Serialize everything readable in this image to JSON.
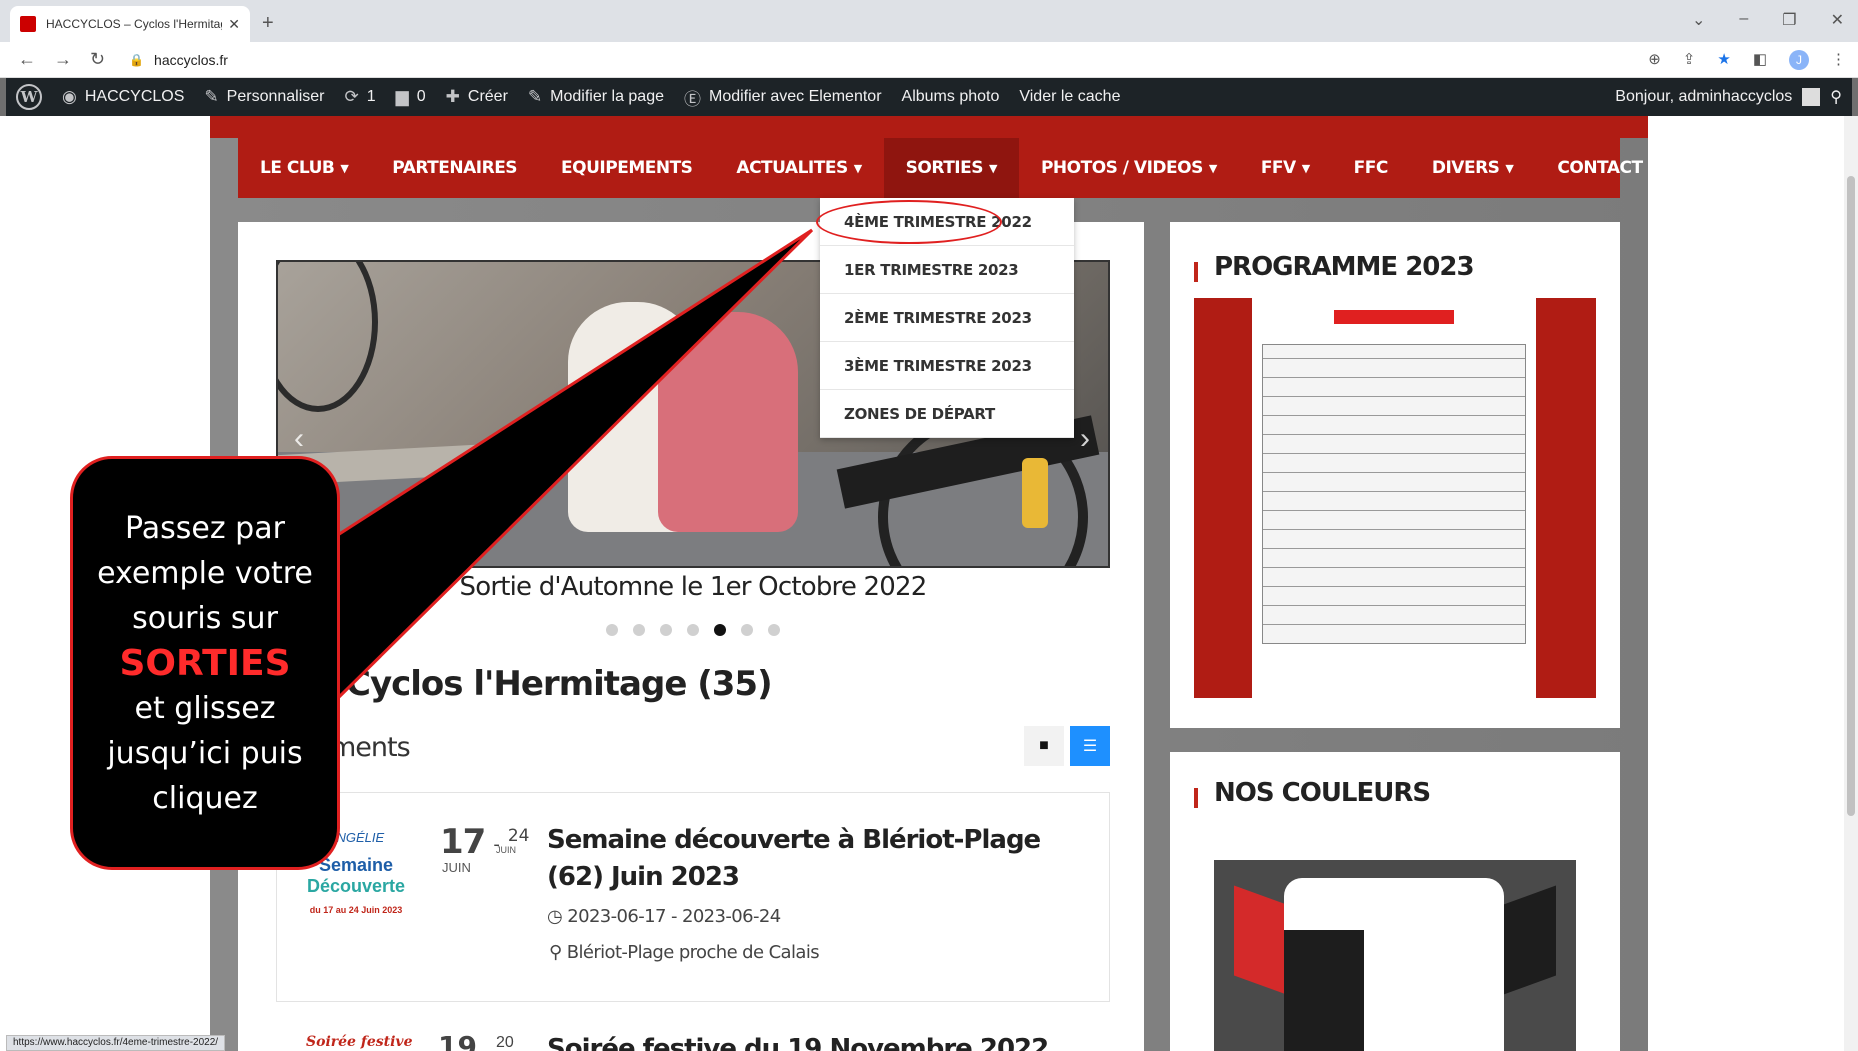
{
  "browser": {
    "tab_title": "HACCYCLOS – Cyclos l'Hermitage",
    "new_tab": "+",
    "url": "haccyclos.fr",
    "status_url": "https://www.haccyclos.fr/4eme-trimestre-2022/"
  },
  "adminbar": {
    "site_name": "HACCYCLOS",
    "customize": "Personnaliser",
    "updates_count": "1",
    "comments_count": "0",
    "create": "Créer",
    "edit_page": "Modifier la page",
    "edit_elementor": "Modifier avec Elementor",
    "albums": "Albums photo",
    "clear_cache": "Vider le cache",
    "greeting": "Bonjour, adminhaccyclos"
  },
  "nav": {
    "items": [
      {
        "label": "LE CLUB",
        "has_sub": true
      },
      {
        "label": "PARTENAIRES",
        "has_sub": false
      },
      {
        "label": "EQUIPEMENTS",
        "has_sub": false
      },
      {
        "label": "ACTUALITES",
        "has_sub": true
      },
      {
        "label": "SORTIES",
        "has_sub": true
      },
      {
        "label": "PHOTOS / VIDEOS",
        "has_sub": true
      },
      {
        "label": "FFV",
        "has_sub": true
      },
      {
        "label": "FFC",
        "has_sub": false
      },
      {
        "label": "DIVERS",
        "has_sub": true
      },
      {
        "label": "CONTACT",
        "has_sub": false
      }
    ],
    "dropdown": [
      "4ÈME TRIMESTRE 2022",
      "1ER TRIMESTRE 2023",
      "2ÈME TRIMESTRE 2023",
      "3ÈME TRIMESTRE 2023",
      "ZONES DE DÉPART"
    ]
  },
  "slider": {
    "caption": "Sortie d'Automne le 1er Octobre 2022",
    "active_dot": 4,
    "dot_count": 7
  },
  "main": {
    "club_title": "Cyclos l'Hermitage (35)",
    "events_sub": "ments"
  },
  "events": [
    {
      "thumb_top": "ANGÉLIE",
      "thumb_line1": "Semaine",
      "thumb_line2": "Découverte",
      "thumb_dates": "du 17 au 24 Juin 2023",
      "day_start": "17",
      "day_end": "24",
      "month_start": "JUIN",
      "month_end": "JUIN",
      "title": "Semaine découverte à Blériot-Plage (62) Juin 2023",
      "dates": "2023-06-17 - 2023-06-24",
      "place": "Blériot-Plage proche de Calais"
    },
    {
      "thumb_top": "Soirée festive",
      "day_start": "19",
      "day_end": "20",
      "title": "Soirée festive du 19 Novembre 2022"
    }
  ],
  "sidebar": {
    "programme_title": "PROGRAMME 2023",
    "couleurs_title": "NOS COULEURS"
  },
  "callout": {
    "line_before": "Passez par exemple votre souris sur",
    "highlight": "SORTIES",
    "line_after": "et glissez jusqu’ici puis cliquez"
  },
  "colors": {
    "brand_red": "#b01c14",
    "admin_bar": "#1d2327",
    "callout_highlight": "#ff2b2b",
    "list_toggle": "#1e90ff"
  }
}
